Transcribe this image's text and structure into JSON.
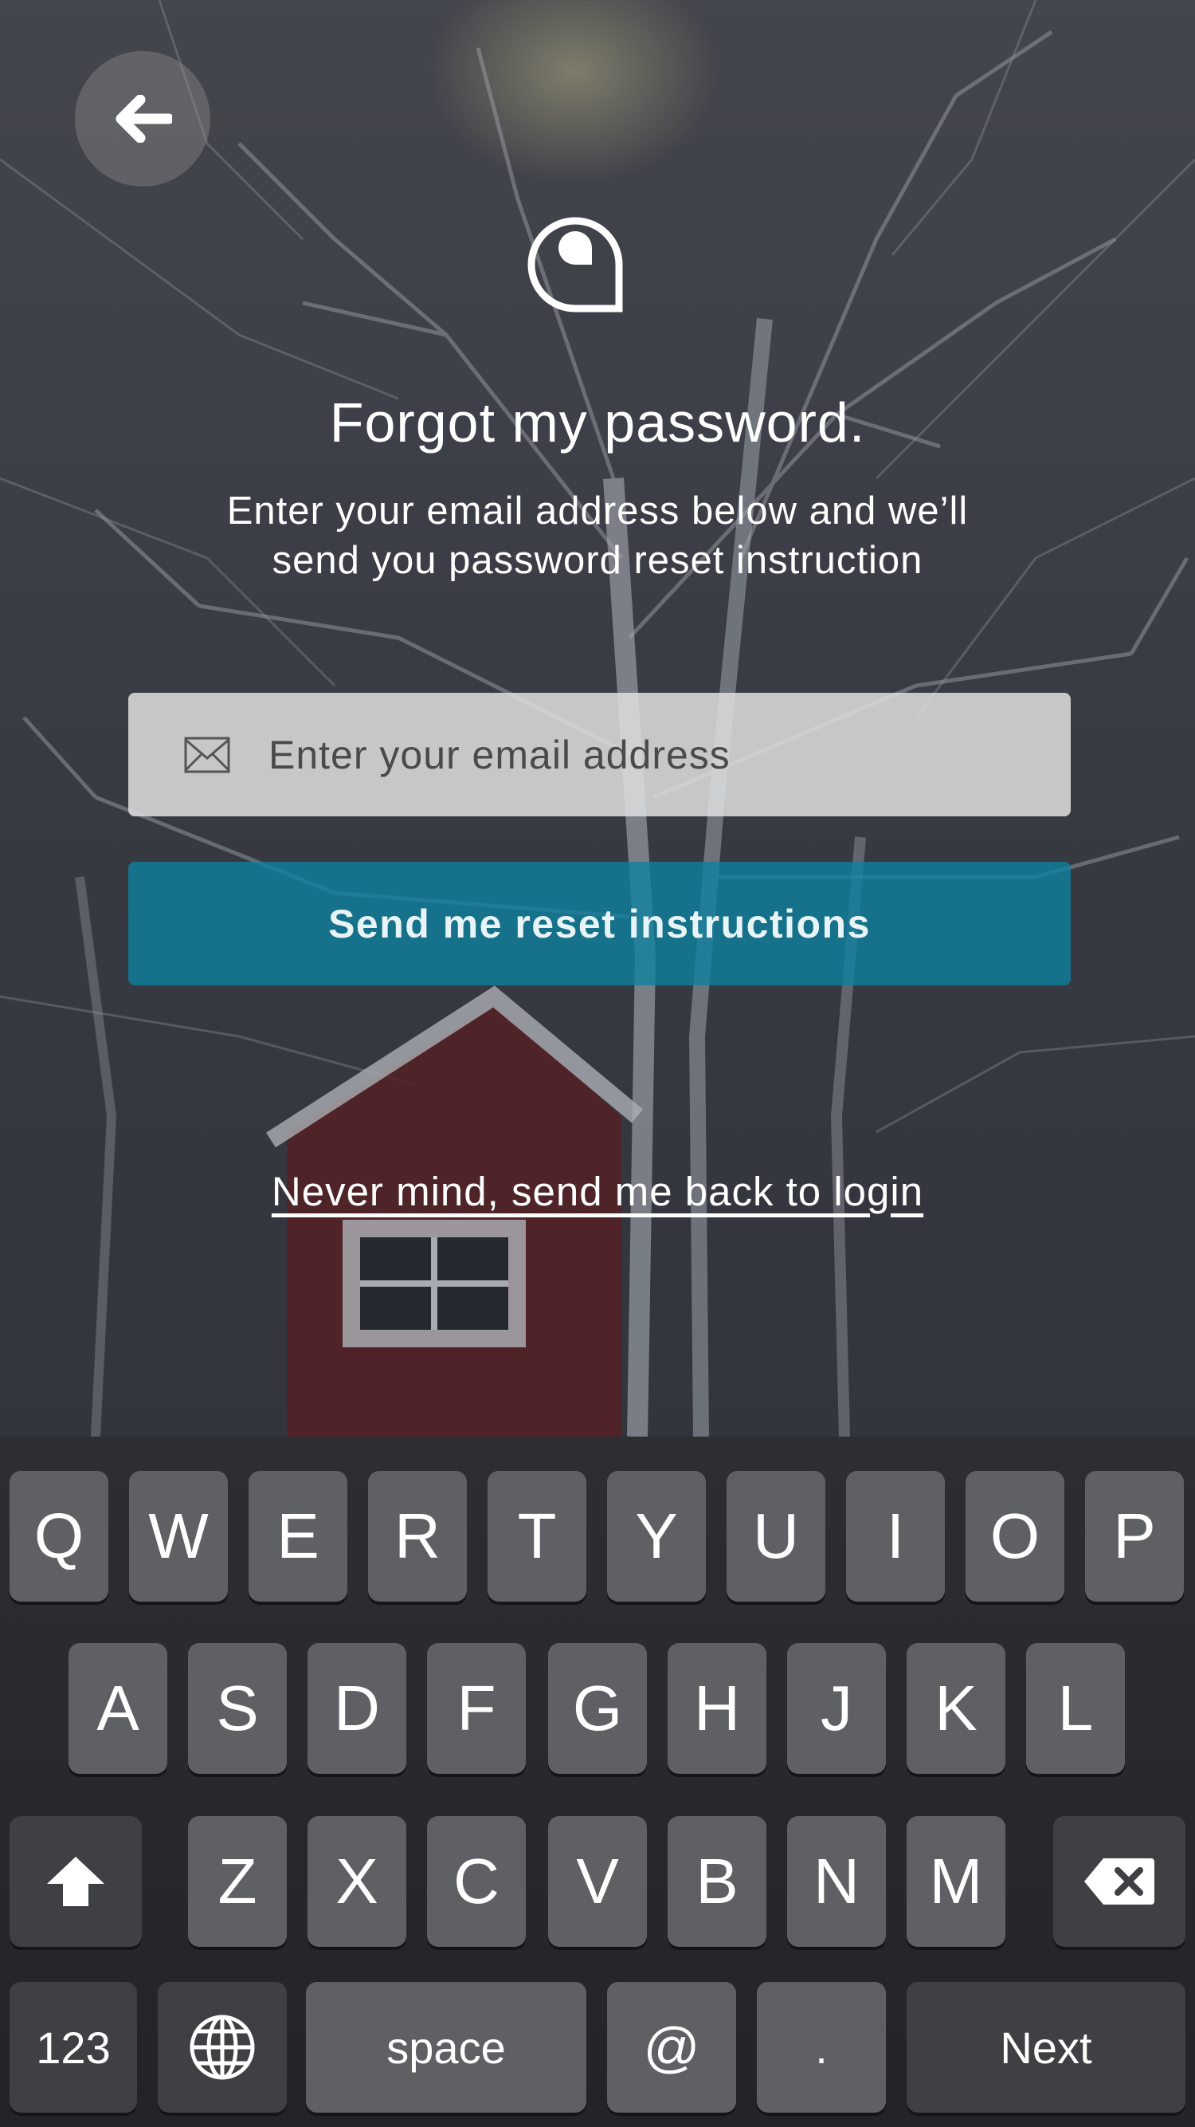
{
  "header": {
    "back_icon": "arrow-left-icon",
    "logo_icon": "chat-bubble-logo-icon"
  },
  "page": {
    "title": "Forgot my password.",
    "subtitle_line1": "Enter your email address below and we’ll",
    "subtitle_line2": "send you password reset instruction"
  },
  "form": {
    "email_icon": "envelope-icon",
    "email_placeholder": "Enter your email address",
    "email_value": "",
    "submit_label": "Send me reset instructions",
    "back_link": "Never mind, send me back to login"
  },
  "colors": {
    "accent": "#0d82a0",
    "text": "#ffffff"
  },
  "keyboard": {
    "row1": [
      "Q",
      "W",
      "E",
      "R",
      "T",
      "Y",
      "U",
      "I",
      "O",
      "P"
    ],
    "row2": [
      "A",
      "S",
      "D",
      "F",
      "G",
      "H",
      "J",
      "K",
      "L"
    ],
    "row3": [
      "Z",
      "X",
      "C",
      "V",
      "B",
      "N",
      "M"
    ],
    "shift_icon": "shift-arrow-icon",
    "backspace_icon": "backspace-icon",
    "numbers_label": "123",
    "globe_icon": "globe-icon",
    "space_label": "space",
    "at_label": "@",
    "dot_label": ".",
    "next_label": "Next"
  }
}
